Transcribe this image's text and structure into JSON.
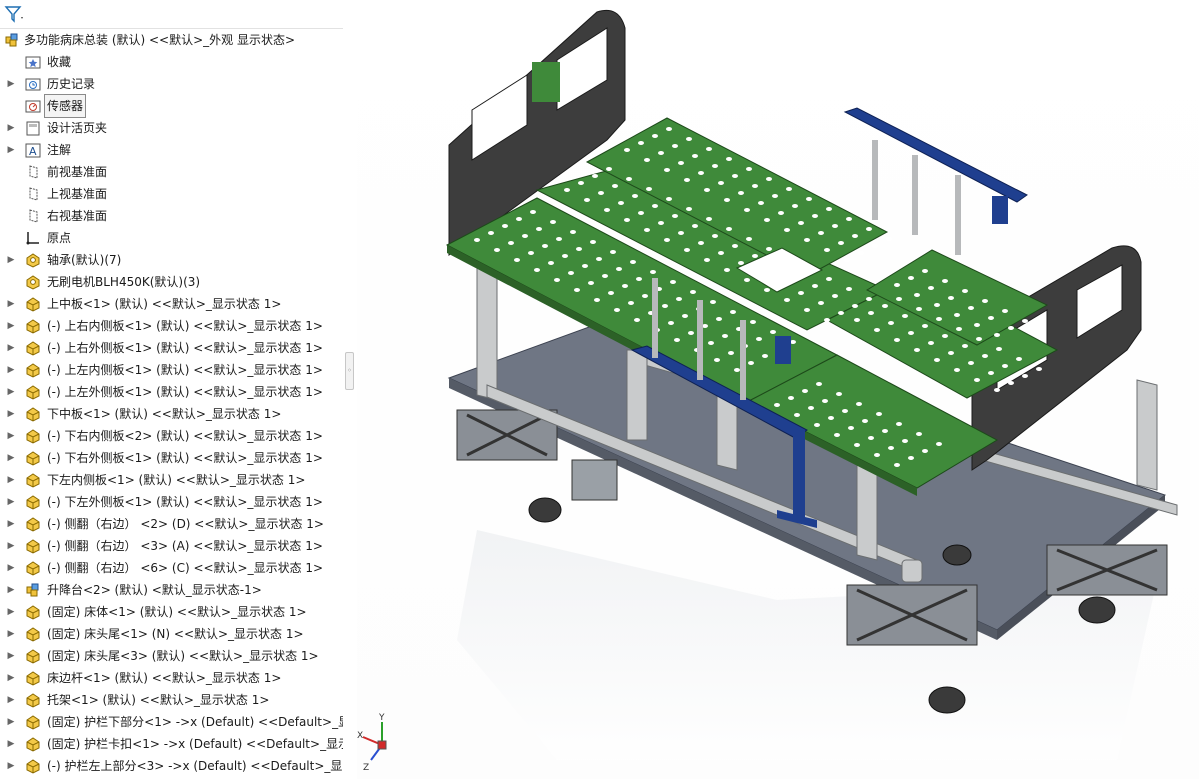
{
  "feature_tree": {
    "filter_icon": "filter-icon",
    "items": [
      {
        "label": "多功能病床总装 (默认) <<默认>_外观 显示状态>",
        "icon": "assembly-icon",
        "arrow": false,
        "indent": 0
      },
      {
        "label": "收藏",
        "icon": "favorites-folder-icon",
        "arrow": false,
        "indent": 1
      },
      {
        "label": "历史记录",
        "icon": "history-icon",
        "arrow": true,
        "indent": 1
      },
      {
        "label": "传感器",
        "icon": "sensor-icon",
        "arrow": false,
        "indent": 1,
        "selected": true
      },
      {
        "label": "设计活页夹",
        "icon": "design-binder-icon",
        "arrow": true,
        "indent": 1
      },
      {
        "label": "注解",
        "icon": "annotation-icon",
        "arrow": true,
        "indent": 1
      },
      {
        "label": "前视基准面",
        "icon": "plane-icon",
        "arrow": false,
        "indent": 1
      },
      {
        "label": "上视基准面",
        "icon": "plane-icon",
        "arrow": false,
        "indent": 1
      },
      {
        "label": "右视基准面",
        "icon": "plane-icon",
        "arrow": false,
        "indent": 1
      },
      {
        "label": "原点",
        "icon": "origin-icon",
        "arrow": false,
        "indent": 1
      },
      {
        "label": "轴承(默认)(7)",
        "icon": "toolbox-part-icon",
        "arrow": true,
        "indent": 1
      },
      {
        "label": "无刷电机BLH450K(默认)(3)",
        "icon": "toolbox-part-icon",
        "arrow": false,
        "indent": 1
      },
      {
        "label": "上中板<1> (默认) <<默认>_显示状态 1>",
        "icon": "part-icon",
        "arrow": true,
        "indent": 1
      },
      {
        "label": "(-) 上右内侧板<1> (默认) <<默认>_显示状态 1>",
        "icon": "part-icon",
        "arrow": true,
        "indent": 1
      },
      {
        "label": "(-) 上右外侧板<1> (默认) <<默认>_显示状态 1>",
        "icon": "part-icon",
        "arrow": true,
        "indent": 1
      },
      {
        "label": "(-) 上左内侧板<1> (默认) <<默认>_显示状态 1>",
        "icon": "part-icon",
        "arrow": true,
        "indent": 1
      },
      {
        "label": "(-) 上左外侧板<1> (默认) <<默认>_显示状态 1>",
        "icon": "part-icon",
        "arrow": true,
        "indent": 1
      },
      {
        "label": "下中板<1> (默认) <<默认>_显示状态 1>",
        "icon": "part-icon",
        "arrow": true,
        "indent": 1
      },
      {
        "label": "(-) 下右内侧板<2> (默认) <<默认>_显示状态 1>",
        "icon": "part-icon",
        "arrow": true,
        "indent": 1
      },
      {
        "label": "(-) 下右外侧板<1> (默认) <<默认>_显示状态 1>",
        "icon": "part-icon",
        "arrow": true,
        "indent": 1
      },
      {
        "label": "下左内侧板<1> (默认) <<默认>_显示状态 1>",
        "icon": "part-icon",
        "arrow": true,
        "indent": 1
      },
      {
        "label": "(-) 下左外侧板<1> (默认) <<默认>_显示状态 1>",
        "icon": "part-icon",
        "arrow": true,
        "indent": 1
      },
      {
        "label": "(-) 侧翻（右边） <2> (D) <<默认>_显示状态 1>",
        "icon": "part-icon",
        "arrow": true,
        "indent": 1
      },
      {
        "label": "(-) 侧翻（右边） <3> (A) <<默认>_显示状态 1>",
        "icon": "part-icon",
        "arrow": true,
        "indent": 1
      },
      {
        "label": "(-) 侧翻（右边） <6> (C) <<默认>_显示状态 1>",
        "icon": "part-icon",
        "arrow": true,
        "indent": 1
      },
      {
        "label": "升降台<2> (默认) <默认_显示状态-1>",
        "icon": "subassembly-icon",
        "arrow": true,
        "indent": 1
      },
      {
        "label": "(固定) 床体<1> (默认) <<默认>_显示状态 1>",
        "icon": "part-icon",
        "arrow": true,
        "indent": 1
      },
      {
        "label": "(固定) 床头尾<1> (N) <<默认>_显示状态 1>",
        "icon": "part-icon",
        "arrow": true,
        "indent": 1
      },
      {
        "label": "(固定) 床头尾<3> (默认) <<默认>_显示状态 1>",
        "icon": "part-icon",
        "arrow": true,
        "indent": 1
      },
      {
        "label": "床边杆<1> (默认) <<默认>_显示状态 1>",
        "icon": "part-icon",
        "arrow": true,
        "indent": 1
      },
      {
        "label": "托架<1> (默认) <<默认>_显示状态 1>",
        "icon": "part-icon",
        "arrow": true,
        "indent": 1
      },
      {
        "label": "(固定) 护栏下部分<1> ->x (Default) <<Default>_显",
        "icon": "part-icon",
        "arrow": true,
        "indent": 1
      },
      {
        "label": "(固定) 护栏卡扣<1> ->x (Default) <<Default>_显示",
        "icon": "part-icon",
        "arrow": true,
        "indent": 1
      },
      {
        "label": "(-) 护栏左上部分<3> ->x (Default) <<Default>_显",
        "icon": "part-icon",
        "arrow": true,
        "indent": 1
      }
    ]
  },
  "splitter": {
    "grip_glyph": "◦"
  },
  "viewport": {
    "model": "multifunction-hospital-bed-assembly",
    "triad": {
      "y_label": "Y",
      "x_label": "X",
      "z_label": "Z"
    },
    "colors": {
      "deck": "#3f8a3a",
      "deck_hole": "#ffffff",
      "headboard": "#3d3d3d",
      "frame": "#c9cbcc",
      "base": "#6f7684",
      "rail": "#1f3f8f",
      "wheel": "#3a3a3a"
    }
  }
}
